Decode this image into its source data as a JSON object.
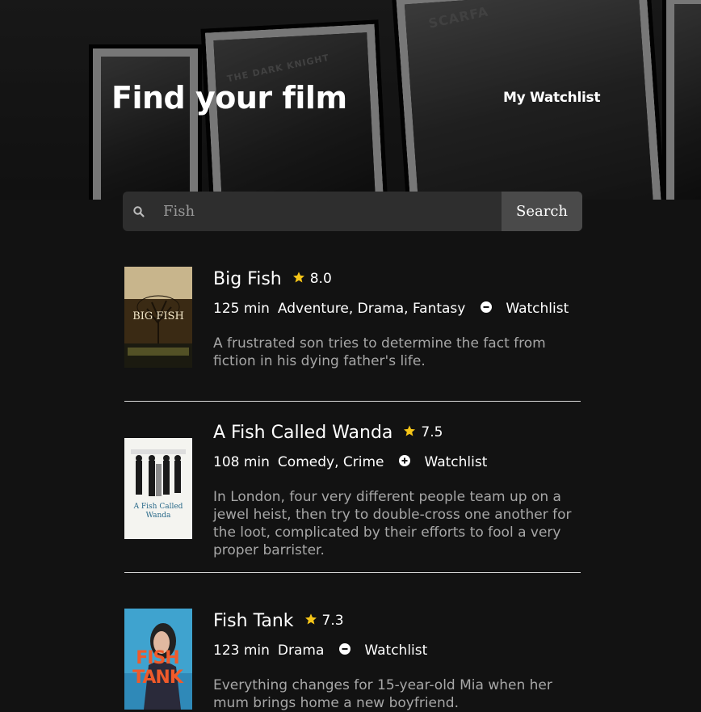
{
  "header": {
    "title": "Find your film",
    "watchlist_link": "My Watchlist",
    "hero_poster_texts": [
      "SCARFA",
      "THE DARK KNIGHT"
    ]
  },
  "search": {
    "value": "Fish",
    "button_label": "Search",
    "icon": "search-icon"
  },
  "colors": {
    "background": "#121212",
    "star": "#f5c518",
    "search_bg": "#2e2e2e",
    "search_button_bg": "#4a4a4a",
    "description_text": "#a7a7a7"
  },
  "films": [
    {
      "title": "Big Fish",
      "rating": "8.0",
      "runtime": "125 min",
      "genres": "Adventure, Drama, Fantasy",
      "watchlist_action": "remove",
      "watchlist_icon": "minus-circle-icon",
      "watchlist_label": "Watchlist",
      "description": "A frustrated son tries to determine the fact from fiction in his dying father's life.",
      "poster_text": "BIG FISH"
    },
    {
      "title": "A Fish Called Wanda",
      "rating": "7.5",
      "runtime": "108 min",
      "genres": "Comedy, Crime",
      "watchlist_action": "add",
      "watchlist_icon": "plus-circle-icon",
      "watchlist_label": "Watchlist",
      "description": "In London, four very different people team up on a jewel heist, then try to double-cross one another for the loot, complicated by their efforts to fool a very proper barrister.",
      "poster_text": "A Fish Called Wanda"
    },
    {
      "title": "Fish Tank",
      "rating": "7.3",
      "runtime": "123 min",
      "genres": "Drama",
      "watchlist_action": "remove",
      "watchlist_icon": "minus-circle-icon",
      "watchlist_label": "Watchlist",
      "description": "Everything changes for 15-year-old Mia when her mum brings home a new boyfriend.",
      "poster_text": "FISH TANK"
    }
  ]
}
